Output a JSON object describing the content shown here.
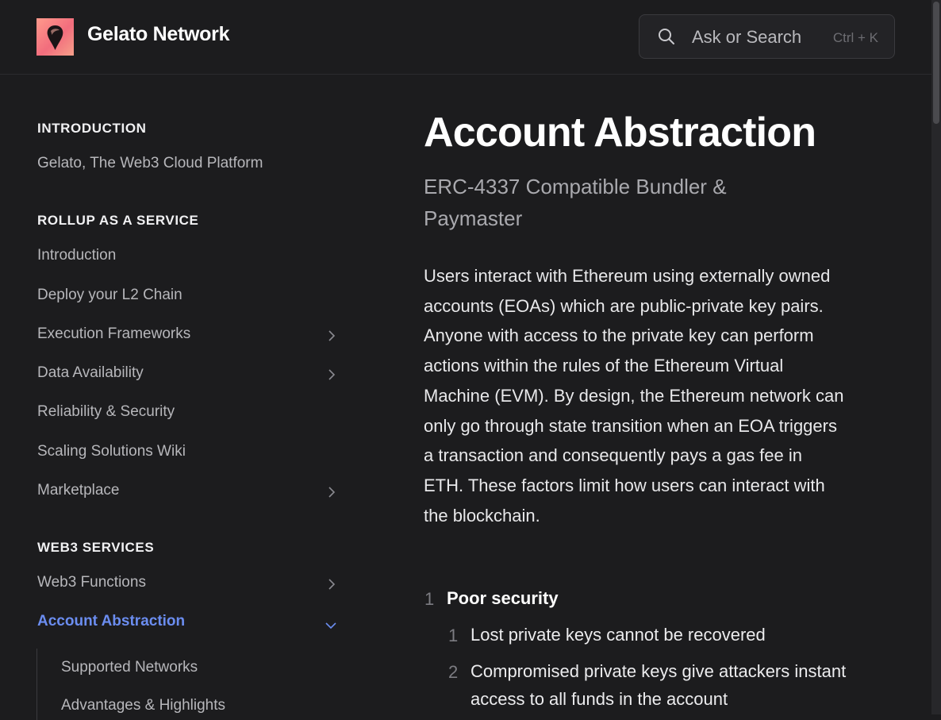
{
  "header": {
    "brand": "Gelato Network",
    "search_placeholder": "Ask or Search",
    "search_shortcut": "Ctrl + K"
  },
  "sidebar": {
    "sections": [
      {
        "title": "INTRODUCTION",
        "items": [
          {
            "label": "Gelato, The Web3 Cloud Platform"
          }
        ]
      },
      {
        "title": "ROLLUP AS A SERVICE",
        "items": [
          {
            "label": "Introduction"
          },
          {
            "label": "Deploy your L2 Chain"
          },
          {
            "label": "Execution Frameworks",
            "expandable": true
          },
          {
            "label": "Data Availability",
            "expandable": true
          },
          {
            "label": "Reliability & Security"
          },
          {
            "label": "Scaling Solutions Wiki"
          },
          {
            "label": "Marketplace",
            "expandable": true
          }
        ]
      },
      {
        "title": "WEB3 SERVICES",
        "items": [
          {
            "label": "Web3 Functions",
            "expandable": true
          },
          {
            "label": "Account Abstraction",
            "expandable": true,
            "active": true,
            "expanded": true
          }
        ]
      }
    ],
    "sub_items": [
      {
        "label": "Supported Networks"
      },
      {
        "label": "Advantages & Highlights"
      }
    ]
  },
  "main": {
    "title": "Account Abstraction",
    "subtitle": "ERC-4337 Compatible Bundler & Paymaster",
    "paragraph": "Users interact with Ethereum using externally owned accounts (EOAs) which are public-private key pairs. Anyone with access to the private key can perform actions within the rules of the Ethereum Virtual Machine (EVM). By design, the Ethereum network can only go through state transition when an EOA triggers a transaction and consequently pays a gas fee in ETH. These factors limit how users can interact with the blockchain.",
    "list": [
      {
        "num": "1",
        "text": "Poor security",
        "children": [
          {
            "num": "1",
            "text": "Lost private keys cannot be recovered"
          },
          {
            "num": "2",
            "text": "Compromised private keys give attackers instant access to all funds in the account"
          }
        ]
      }
    ]
  },
  "colors": {
    "accent": "#6b8df0",
    "background": "#1c1c1e"
  }
}
